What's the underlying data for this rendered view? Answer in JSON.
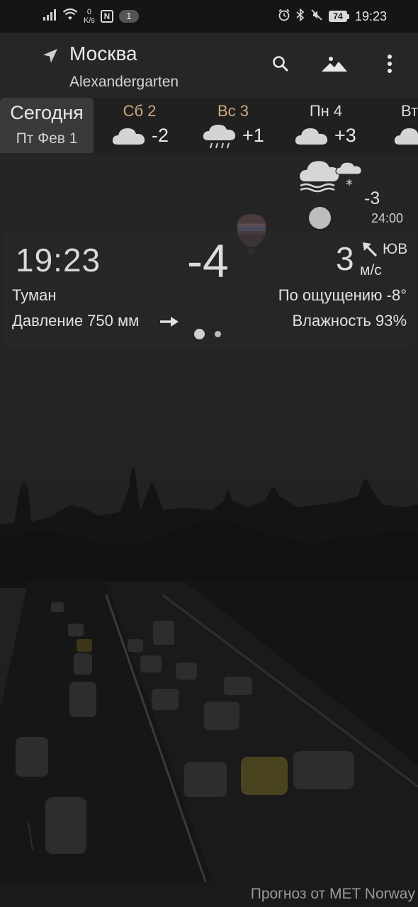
{
  "status_bar": {
    "net_speed_value": "0",
    "net_speed_unit": "K/s",
    "nfc_label": "N",
    "notification_count": "1",
    "battery_level": "74",
    "time": "19:23"
  },
  "header": {
    "city": "Москва",
    "district": "Alexandergarten"
  },
  "forecast": {
    "today": {
      "title": "Сегодня",
      "date": "Пт Фев 1"
    },
    "days": [
      {
        "name": "Сб 2",
        "temp": "-2",
        "icon": "cloud-icon",
        "name_color": "#d2aa82"
      },
      {
        "name": "Вс 3",
        "temp": "+1",
        "icon": "rain-cloud-icon",
        "name_color": "#d2aa82"
      },
      {
        "name": "Пн 4",
        "temp": "+3",
        "icon": "cloud-icon",
        "name_color": "#dcdcdc"
      },
      {
        "name": "Вт",
        "temp": "",
        "icon": "cloud-icon",
        "name_color": "#dcdcdc"
      }
    ]
  },
  "current": {
    "icon": "fog-snow-icon",
    "next_temp": "-3",
    "next_time": "24:00",
    "time": "19:23",
    "temperature": "-4",
    "wind_speed": "3",
    "wind_direction": "ЮВ",
    "wind_unit": "м/с",
    "condition": "Туман",
    "feels_like": "По ощущению -8°",
    "pressure": "Давление 750 мм",
    "humidity": "Влажность 93%"
  },
  "footer": {
    "credit": "Прогноз от MET Norway"
  }
}
